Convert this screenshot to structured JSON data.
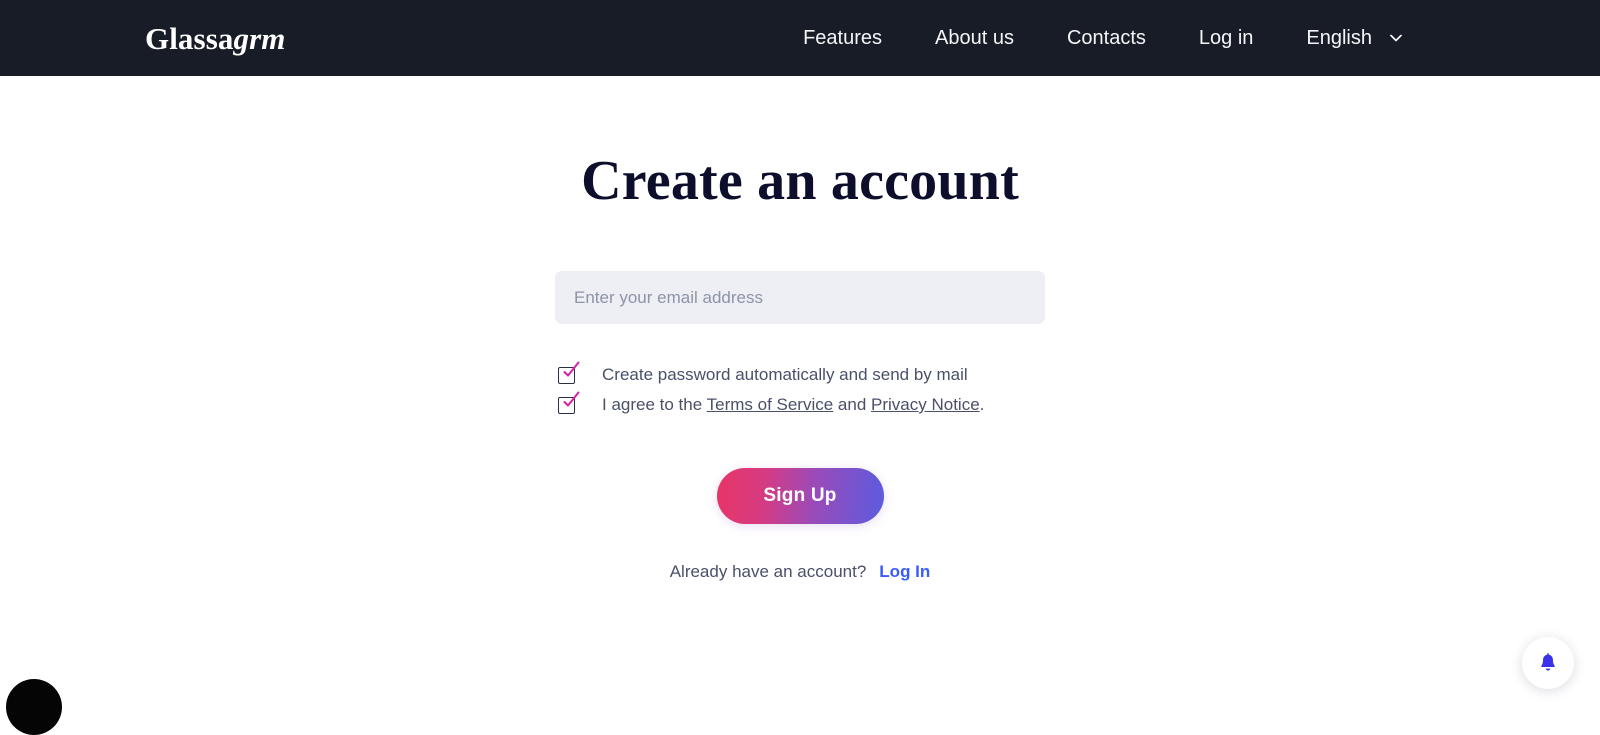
{
  "header": {
    "brand": {
      "primary": "Glassa",
      "italic": "grm"
    },
    "nav": [
      {
        "label": "Features",
        "name": "nav-link-features"
      },
      {
        "label": "About us",
        "name": "nav-link-about-us"
      },
      {
        "label": "Contacts",
        "name": "nav-link-contacts"
      },
      {
        "label": "Log in",
        "name": "nav-link-log-in"
      }
    ],
    "language": {
      "label": "English",
      "icon": "chevron-down-icon"
    },
    "background_color": "#181c26"
  },
  "main": {
    "title": "Create an account",
    "email": {
      "placeholder": "Enter your email address",
      "value": ""
    },
    "checkboxes": [
      {
        "label": "Create password automatically and send by mail",
        "checked": true
      },
      {
        "prefix": "I agree to the ",
        "link1": "Terms of Service",
        "middle": " and ",
        "link2": "Privacy Notice",
        "suffix": ".",
        "checked": true
      }
    ],
    "signup_label": "Sign Up",
    "login_prompt": "Already have an account?",
    "login_label": "Log In"
  },
  "widgets": {
    "notification": {
      "icon": "bell-icon"
    },
    "chat": {
      "icon": "chat-bubble-icon"
    }
  },
  "colors": {
    "accent_pink": "#e83566",
    "accent_blue": "#5b5be0",
    "link_blue": "#3a5bfd",
    "checkbox_check": "#d81fa5",
    "title": "#0d0e2b",
    "body_text": "#4a5069"
  }
}
